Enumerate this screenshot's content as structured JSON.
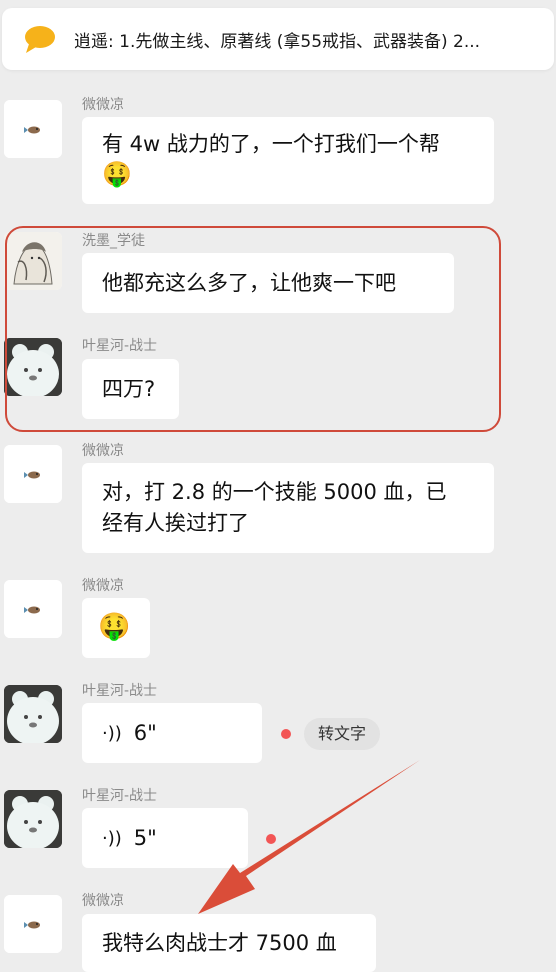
{
  "pinned": {
    "icon": "speech-bubble-icon",
    "text": "逍遥: 1.先做主线、原著线 (拿55戒指、武器装备) 2..."
  },
  "messages": [
    {
      "sender": "微微凉",
      "avatar": "small-fish-avatar",
      "text": "有 4w 战力的了，一个打我们一个帮",
      "emoji": "🤑"
    },
    {
      "sender": "洗墨_学徒",
      "avatar": "anime-drawing-avatar",
      "text": "他都充这么多了，让他爽一下吧"
    },
    {
      "sender": "叶星河-战士",
      "avatar": "bear-avatar",
      "text": "四万?"
    },
    {
      "sender": "微微凉",
      "avatar": "small-fish-avatar",
      "text_line1": "对，打 2.8 的一个技能 5000 血，已",
      "text_line2": "经有人挨过打了"
    },
    {
      "sender": "微微凉",
      "avatar": "small-fish-avatar",
      "emoji": "🤑"
    },
    {
      "sender": "叶星河-战士",
      "avatar": "bear-avatar",
      "voice_duration": "6\"",
      "convert_label": "转文字"
    },
    {
      "sender": "叶星河-战士",
      "avatar": "bear-avatar",
      "voice_duration": "5\""
    },
    {
      "sender": "微微凉",
      "avatar": "small-fish-avatar",
      "text": "我特么肉战士才 7500 血"
    }
  ],
  "colors": {
    "annotation": "#cf4a3a",
    "unread_dot": "#f25555",
    "bubble": "#ffffff",
    "background": "#ededed"
  }
}
